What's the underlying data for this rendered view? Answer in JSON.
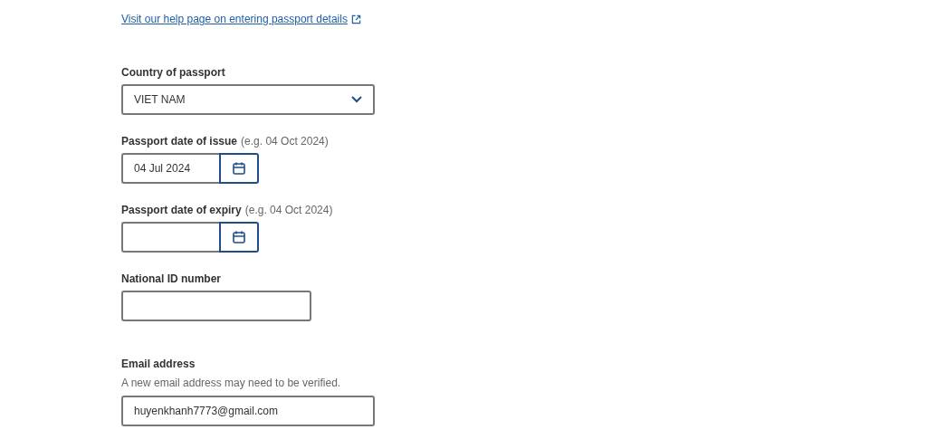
{
  "help_link": "Visit our help page on entering passport details",
  "fields": [
    {
      "kind": "select",
      "label": "Country of passport",
      "value": "VIET NAM"
    },
    {
      "kind": "date",
      "label": "Passport date of issue",
      "example": "(e.g. 04 Oct 2024)",
      "value": "04 Jul 2024"
    },
    {
      "kind": "date",
      "label": "Passport date of expiry",
      "example": "(e.g. 04 Oct 2024)"
    },
    {
      "kind": "text",
      "label": "National ID number"
    },
    {
      "kind": "email",
      "label": "Email address",
      "hint": "A new email address may need to be verified.",
      "value": "huyenkhanh7773@gmail.com"
    }
  ]
}
